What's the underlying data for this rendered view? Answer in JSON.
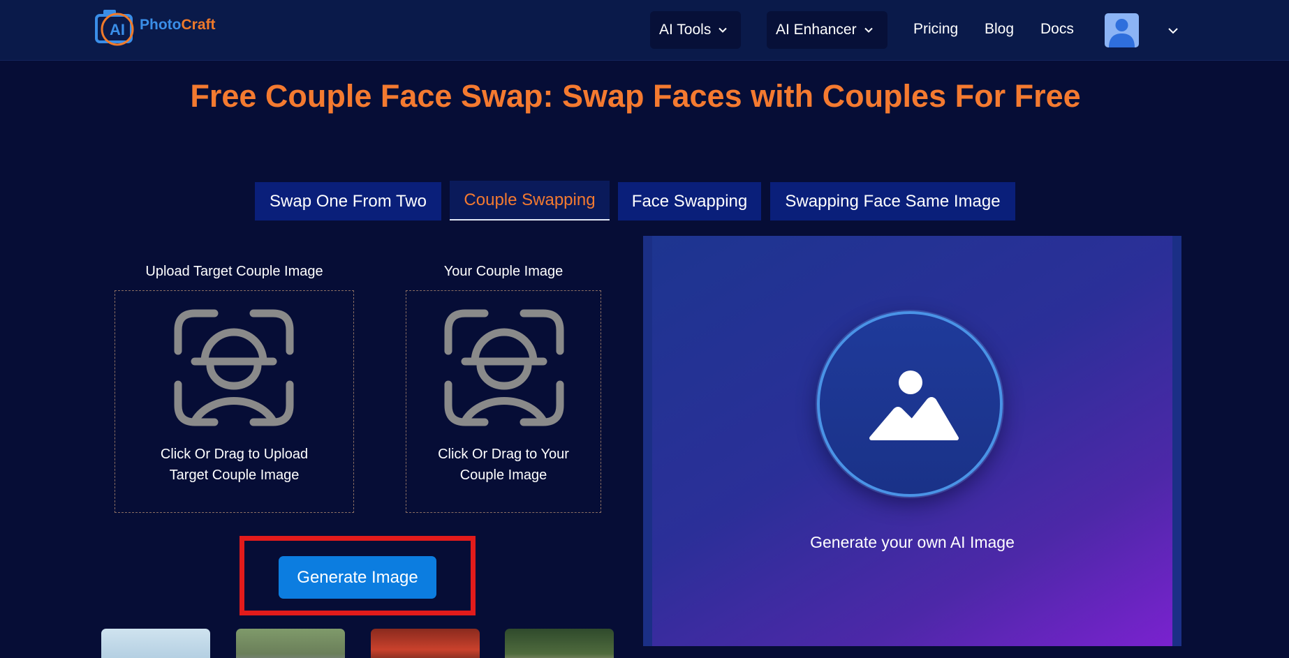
{
  "header": {
    "logo": {
      "part1": "Photo",
      "part2": "Craft",
      "badge": "AI"
    },
    "nav": {
      "ai_tools": "AI Tools",
      "ai_enhancer": "AI Enhancer",
      "pricing": "Pricing",
      "blog": "Blog",
      "docs": "Docs"
    }
  },
  "page": {
    "title": "Free Couple Face Swap: Swap Faces with Couples For Free"
  },
  "tabs": [
    {
      "label": "Swap One From Two",
      "active": false
    },
    {
      "label": "Couple Swapping",
      "active": true
    },
    {
      "label": "Face Swapping",
      "active": false
    },
    {
      "label": "Swapping Face Same Image",
      "active": false
    }
  ],
  "uploads": {
    "target": {
      "label": "Upload Target Couple Image",
      "hint_line1": "Click Or Drag to Upload",
      "hint_line2": "Target Couple Image"
    },
    "yours": {
      "label": "Your Couple Image",
      "hint_line1": "Click Or Drag to Your",
      "hint_line2": "Couple Image"
    }
  },
  "generate": {
    "label": "Generate Image"
  },
  "preview": {
    "caption": "Generate your own AI Image"
  },
  "colors": {
    "background": "#060d36",
    "header": "#0a1a4a",
    "accent_orange": "#f47a30",
    "tab_blue": "#0a1f7a",
    "button_blue": "#0c7de0",
    "highlight_red": "#e31b1b"
  },
  "icons": {
    "face_scan": "face-scan-icon",
    "image_placeholder": "image-placeholder-icon",
    "chevron": "chevron-down-icon"
  }
}
